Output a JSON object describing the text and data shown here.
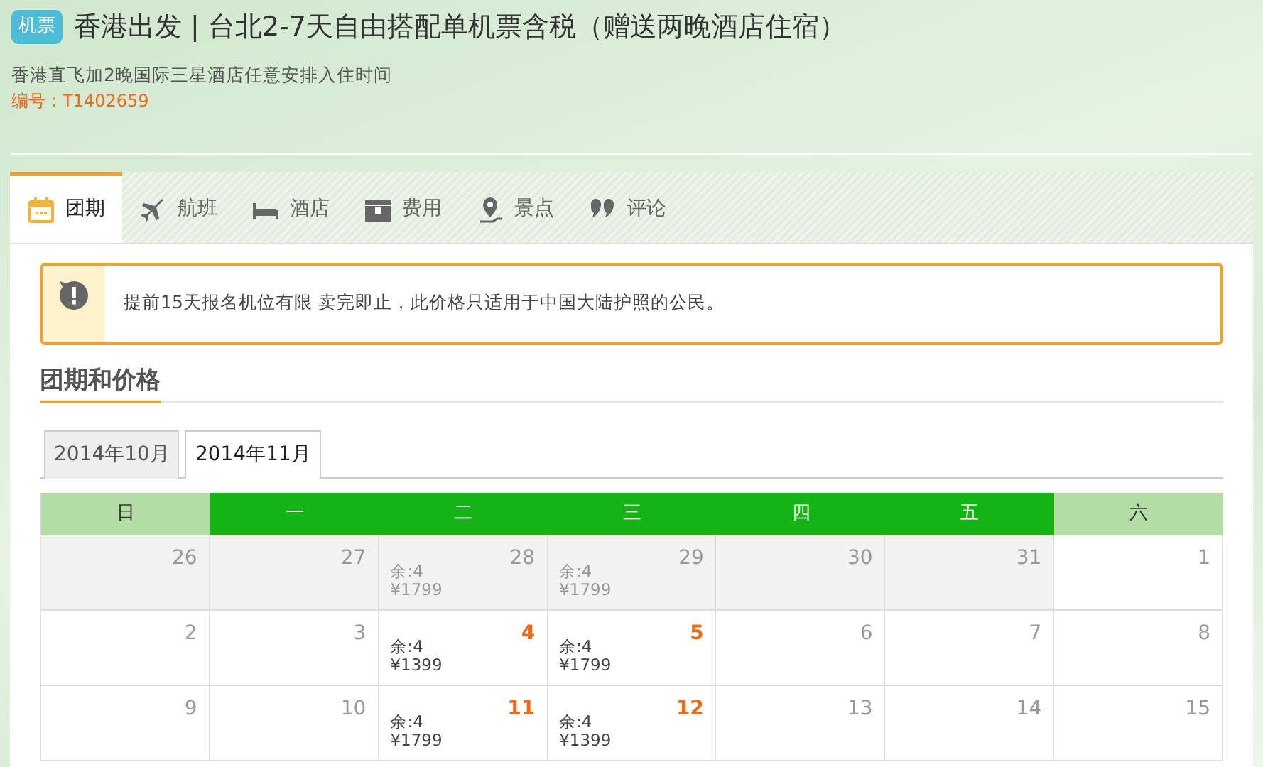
{
  "header": {
    "badge": "机票",
    "title": "香港出发 | 台北2-7天自由搭配单机票含税（赠送两晚酒店住宿）",
    "subtitle": "香港直飞加2晚国际三星酒店任意安排入住时间",
    "code": "编号：T1402659"
  },
  "tabs": [
    {
      "kind": "calendar",
      "label": "团期",
      "selected": true
    },
    {
      "kind": "plane",
      "label": "航班",
      "selected": false
    },
    {
      "kind": "bed",
      "label": "酒店",
      "selected": false
    },
    {
      "kind": "money",
      "label": "费用",
      "selected": false
    },
    {
      "kind": "pin",
      "label": "景点",
      "selected": false
    },
    {
      "kind": "quote",
      "label": "评论",
      "selected": false
    }
  ],
  "notice": "提前15天报名机位有限 卖完即止，此价格只适用于中国大陆护照的公民。",
  "section_title": "团期和价格",
  "month_tabs": [
    {
      "label": "2014年10月",
      "selected": false
    },
    {
      "label": "2014年11月",
      "selected": true
    }
  ],
  "calendar": {
    "weekdays": [
      {
        "label": "日",
        "weekend": true
      },
      {
        "label": "一",
        "weekend": false
      },
      {
        "label": "二",
        "weekend": false
      },
      {
        "label": "三",
        "weekend": false
      },
      {
        "label": "四",
        "weekend": false
      },
      {
        "label": "五",
        "weekend": false
      },
      {
        "label": "六",
        "weekend": true
      }
    ],
    "weeks": [
      [
        {
          "day": "26",
          "in_month": false,
          "available": false
        },
        {
          "day": "27",
          "in_month": false,
          "available": false
        },
        {
          "day": "28",
          "in_month": false,
          "available": false,
          "stock": "余:4",
          "price": "¥1799"
        },
        {
          "day": "29",
          "in_month": false,
          "available": false,
          "stock": "余:4",
          "price": "¥1799"
        },
        {
          "day": "30",
          "in_month": false,
          "available": false
        },
        {
          "day": "31",
          "in_month": false,
          "available": false
        },
        {
          "day": "1",
          "in_month": true,
          "available": false
        }
      ],
      [
        {
          "day": "2",
          "in_month": true,
          "available": false
        },
        {
          "day": "3",
          "in_month": true,
          "available": false
        },
        {
          "day": "4",
          "in_month": true,
          "available": true,
          "stock": "余:4",
          "price": "¥1399"
        },
        {
          "day": "5",
          "in_month": true,
          "available": true,
          "stock": "余:4",
          "price": "¥1799"
        },
        {
          "day": "6",
          "in_month": true,
          "available": false
        },
        {
          "day": "7",
          "in_month": true,
          "available": false
        },
        {
          "day": "8",
          "in_month": true,
          "available": false
        }
      ],
      [
        {
          "day": "9",
          "in_month": true,
          "available": false
        },
        {
          "day": "10",
          "in_month": true,
          "available": false
        },
        {
          "day": "11",
          "in_month": true,
          "available": true,
          "stock": "余:4",
          "price": "¥1799"
        },
        {
          "day": "12",
          "in_month": true,
          "available": true,
          "stock": "余:4",
          "price": "¥1399"
        },
        {
          "day": "13",
          "in_month": true,
          "available": false
        },
        {
          "day": "14",
          "in_month": true,
          "available": false
        },
        {
          "day": "15",
          "in_month": true,
          "available": false
        }
      ]
    ]
  }
}
